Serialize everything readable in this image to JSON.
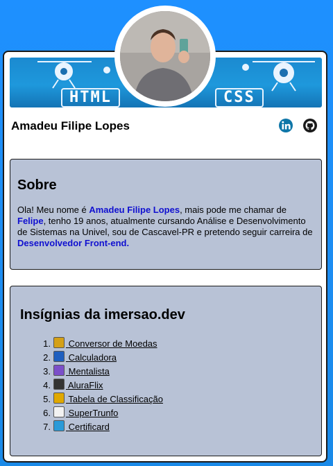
{
  "profile": {
    "name": "Amadeu Filipe Lopes"
  },
  "banner": {
    "left_word": "HTML",
    "right_word": "CSS"
  },
  "social": {
    "linkedin": "linkedin-icon",
    "github": "github-icon"
  },
  "about": {
    "title": "Sobre",
    "t1": "Ola! Meu nome é ",
    "name_highlight": "Amadeu Filipe Lopes",
    "t2": ", mais pode me chamar de ",
    "nick_highlight": "Felipe",
    "t3": ", tenho 19 anos, atualmente cursando Análise e Desenvolvimento de Sistemas na Univel, sou de Cascavel-PR e pretendo seguir carreira de ",
    "career_highlight": "Desenvolvedor Front-end."
  },
  "badges": {
    "title": "Insígnias da imersao.dev",
    "items": [
      {
        "num": "1.",
        "label": "Conversor de Moedas",
        "icon": "money-bag-icon",
        "color": "#d4a017"
      },
      {
        "num": "2.",
        "label": "Calculadora",
        "icon": "calculator-icon",
        "color": "#1f5fbf"
      },
      {
        "num": "3.",
        "label": "Mentalista",
        "icon": "crystal-ball-icon",
        "color": "#7b4fc9"
      },
      {
        "num": "4.",
        "label": "AluraFlix",
        "icon": "clapper-board-icon",
        "color": "#333333"
      },
      {
        "num": "5.",
        "label": "Tabela de Classificação",
        "icon": "trophy-icon",
        "color": "#e0a800"
      },
      {
        "num": "6.",
        "label": "SuperTrunfo",
        "icon": "playing-card-icon",
        "color": "#f2f2f2"
      },
      {
        "num": "7.",
        "label": "Certificard",
        "icon": "globe-icon",
        "color": "#2a9ad8"
      }
    ]
  }
}
